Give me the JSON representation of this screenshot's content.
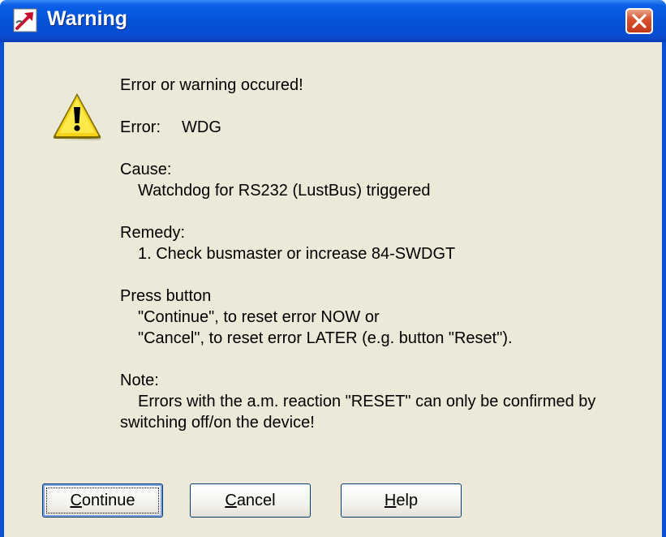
{
  "window": {
    "title": "Warning",
    "colors": {
      "titlebar": "#0553d8",
      "client": "#ece9d8",
      "close": "#d9532f"
    }
  },
  "message": {
    "line1": "Error or warning occured!",
    "error_label": "Error:",
    "error_value": "WDG",
    "cause_label": "Cause:",
    "cause_text": "Watchdog for RS232 (LustBus) triggered",
    "remedy_label": "Remedy:",
    "remedy_text": "1. Check busmaster or increase 84-SWDGT",
    "press_label": "Press button",
    "press_line1": "\"Continue\", to reset error NOW or",
    "press_line2": "\"Cancel\", to reset error LATER (e.g. button \"Reset\").",
    "note_label": "Note:",
    "note_line1": "Errors with the a.m. reaction \"RESET\" can only be confirmed by",
    "note_line2": "switching off/on the device!"
  },
  "buttons": {
    "continue": {
      "first": "C",
      "rest": "ontinue"
    },
    "cancel": {
      "first": "C",
      "rest": "ancel"
    },
    "help": {
      "first": "H",
      "rest": "elp"
    }
  },
  "icons": {
    "title": "app-arrow-icon",
    "warning": "warning-icon",
    "close": "close-icon"
  }
}
